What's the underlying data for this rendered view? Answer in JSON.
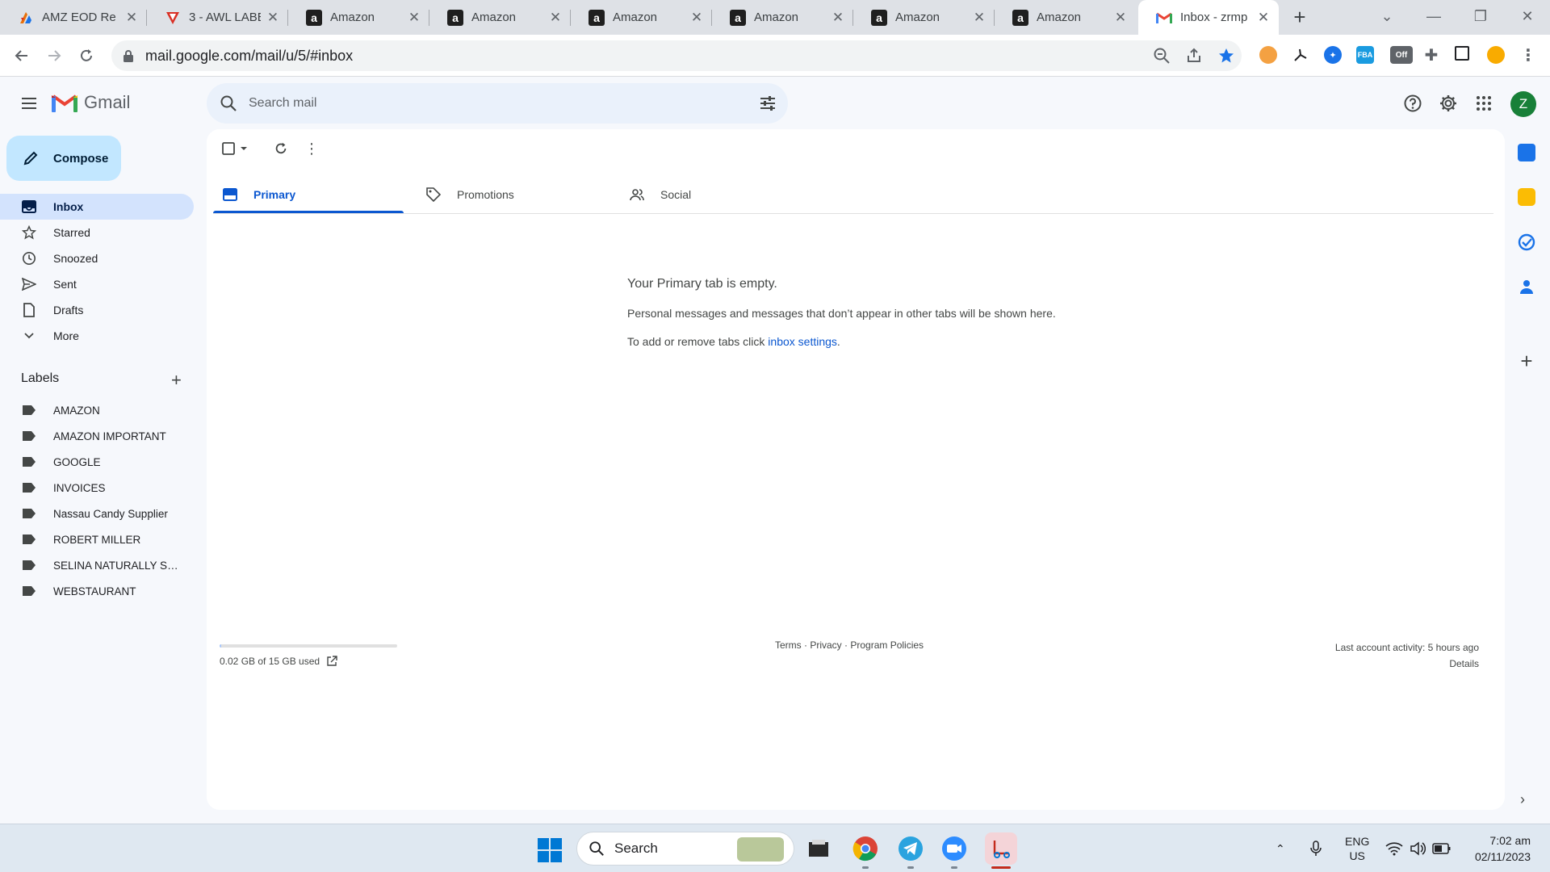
{
  "browser": {
    "tabs": [
      {
        "title": "AMZ EOD Re",
        "icon": "colorful-logo-icon",
        "active": false
      },
      {
        "title": "3 - AWL LABE",
        "icon": "red-v-logo-icon",
        "active": false
      },
      {
        "title": "Amazon",
        "icon": "amazon-icon",
        "active": false
      },
      {
        "title": "Amazon",
        "icon": "amazon-icon",
        "active": false
      },
      {
        "title": "Amazon",
        "icon": "amazon-icon",
        "active": false
      },
      {
        "title": "Amazon",
        "icon": "amazon-icon",
        "active": false
      },
      {
        "title": "Amazon",
        "icon": "amazon-icon",
        "active": false
      },
      {
        "title": "Amazon",
        "icon": "amazon-icon",
        "active": false
      },
      {
        "title": "Inbox - zrmp",
        "icon": "gmail-icon",
        "active": true
      }
    ],
    "url": "mail.google.com/mail/u/5/#inbox",
    "extension_badge": "Off"
  },
  "gmail": {
    "brand": "Gmail",
    "search_placeholder": "Search mail",
    "avatar_letter": "Z",
    "compose_label": "Compose",
    "nav": [
      {
        "label": "Inbox",
        "icon": "inbox-icon",
        "active": true
      },
      {
        "label": "Starred",
        "icon": "star-icon",
        "active": false
      },
      {
        "label": "Snoozed",
        "icon": "clock-icon",
        "active": false
      },
      {
        "label": "Sent",
        "icon": "send-icon",
        "active": false
      },
      {
        "label": "Drafts",
        "icon": "draft-icon",
        "active": false
      },
      {
        "label": "More",
        "icon": "chevron-down-icon",
        "active": false
      }
    ],
    "labels_header": "Labels",
    "labels": [
      "AMAZON",
      "AMAZON IMPORTANT",
      "GOOGLE",
      "INVOICES",
      "Nassau Candy Supplier",
      "ROBERT MILLER",
      "SELINA NATURALLY SU...",
      "WEBSTAURANT"
    ],
    "category_tabs": [
      {
        "label": "Primary",
        "icon": "inbox-icon",
        "active": true
      },
      {
        "label": "Promotions",
        "icon": "tag-icon",
        "active": false
      },
      {
        "label": "Social",
        "icon": "people-icon",
        "active": false
      }
    ],
    "empty_state": {
      "title": "Your Primary tab is empty.",
      "message": "Personal messages and messages that don’t appear in other tabs will be shown here.",
      "settings_prefix": "To add or remove tabs click ",
      "settings_link": "inbox settings",
      "settings_suffix": "."
    },
    "storage": {
      "text": "0.02 GB of 15 GB used",
      "used_fraction": 0.0013
    },
    "footer": {
      "terms": "Terms",
      "privacy": "Privacy",
      "policies": "Program Policies",
      "dot": " · "
    },
    "activity": {
      "text": "Last account activity: 5 hours ago",
      "details": "Details"
    }
  },
  "taskbar": {
    "search": "Search",
    "language": "ENG",
    "region": "US",
    "time": "7:02 am",
    "date": "02/11/2023"
  },
  "colors": {
    "accent": "#0b57d0",
    "compose_bg": "#c2e7ff",
    "nav_active_bg": "#d3e3fd",
    "avatar_bg": "#188038"
  }
}
